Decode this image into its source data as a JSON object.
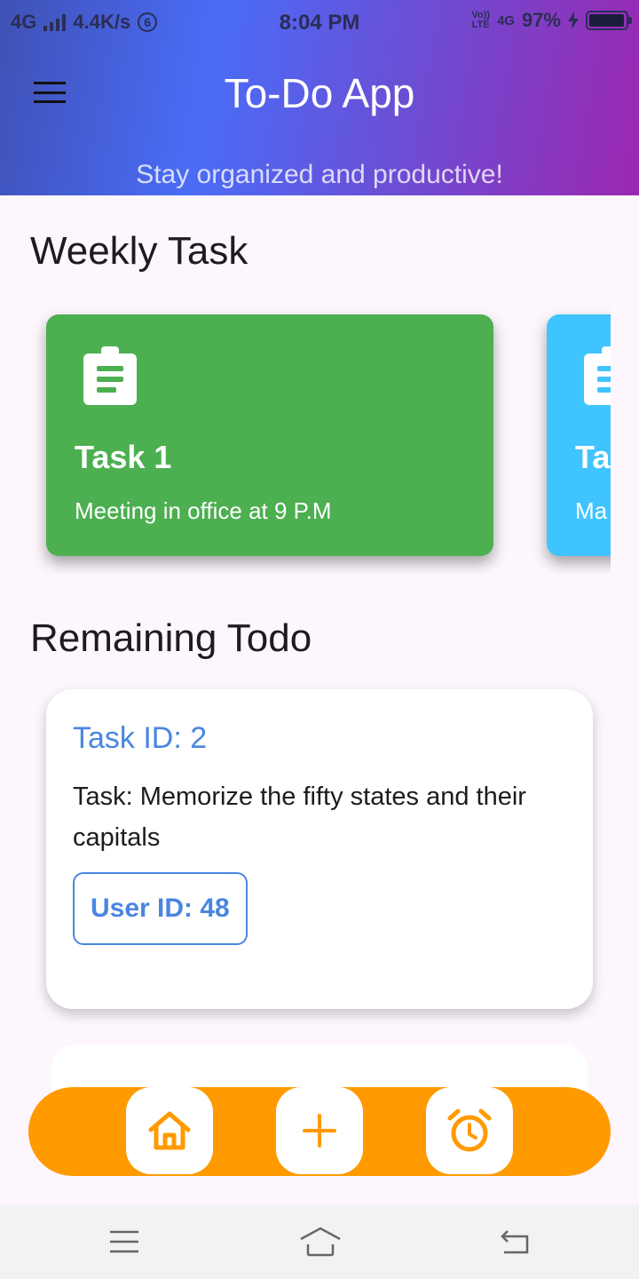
{
  "status_bar": {
    "network": "4G",
    "speed": "4.4K/s",
    "notification_count": "6",
    "time": "8:04 PM",
    "volte_top": "Vo))",
    "volte_bottom": "LTE",
    "net2": "4G",
    "battery": "97%",
    "battery_level": 0.97
  },
  "header": {
    "title": "To-Do App",
    "subtitle": "Stay organized and productive!",
    "menu_icon": "hamburger-menu-icon"
  },
  "weekly": {
    "title": "Weekly Task",
    "cards": [
      {
        "title": "Task 1",
        "description": "Meeting in office at 9 P.M",
        "color": "#4caf50",
        "icon": "clipboard-icon"
      },
      {
        "title": "Ta",
        "description": "Ma",
        "color": "#40c4ff",
        "icon": "clipboard-icon"
      }
    ]
  },
  "remaining": {
    "title": "Remaining Todo",
    "items": [
      {
        "task_id": "Task ID: 2",
        "task": "Task: Memorize the fifty states and their capitals",
        "user": "User ID: 48"
      }
    ]
  },
  "bottom_nav": {
    "color": "#ff9a00",
    "items": [
      {
        "icon": "home-icon"
      },
      {
        "icon": "add-icon"
      },
      {
        "icon": "alarm-icon"
      }
    ]
  },
  "system_nav": {
    "items": [
      "menu-icon",
      "home-icon",
      "back-icon"
    ]
  }
}
